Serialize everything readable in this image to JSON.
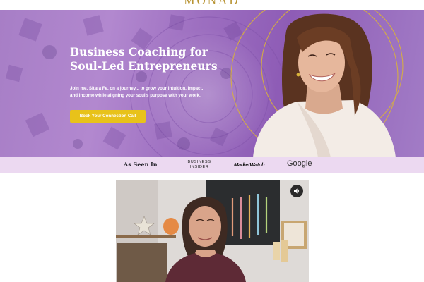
{
  "header": {
    "logo_text": "MONAD"
  },
  "hero": {
    "title_line1": "Business Coaching for",
    "title_line2": "Soul-Led Entrepreneurs",
    "description": "Join me, Sitara Fe, on a journey... to grow your intuition, impact, and income while aligning your soul's purpose with your work.",
    "cta_label": "Book Your Connection Call"
  },
  "press": {
    "label": "As Seen In",
    "logos": [
      "BUSINESS INSIDER",
      "MarketWatch",
      "Google"
    ]
  },
  "video": {
    "volume_icon": "speaker-icon"
  },
  "colors": {
    "hero_purple": "#a77ec6",
    "cta_yellow": "#e8c21a",
    "press_band": "#ecd9f1",
    "logo_gold": "#b89434"
  }
}
